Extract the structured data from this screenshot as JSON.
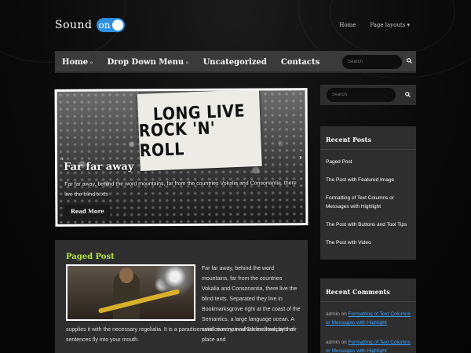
{
  "site": {
    "logo_text": "Sound",
    "logo_toggle": "on",
    "top_nav": [
      "Home",
      "Page layouts ▾"
    ]
  },
  "nav": {
    "items": [
      {
        "label": "Home",
        "arrow": "»"
      },
      {
        "label": "Drop Down Menu",
        "arrow": "»"
      },
      {
        "label": "Uncategorized",
        "arrow": ""
      },
      {
        "label": "Contacts",
        "arrow": ""
      }
    ],
    "search_placeholder": "Search"
  },
  "slider": {
    "sign_line_1": "LONG LIVE",
    "sign_line_2": "ROCK 'N' ROLL",
    "title": "Far far away",
    "text": "Far far away, behind the word mountains, far from the countries Vokalia and Consonantia, there live the blind texts",
    "button": "Read More",
    "prev_icon": "‹",
    "next_icon": "›"
  },
  "post": {
    "title": "Paged Post",
    "text_right": "Far far away, behind the word mountains, far from the countries Vokalia and Consonantia, there live the blind texts. Separated they live in Bookmarksgrove right at the coast of the Semantics, a large language ocean. A small river named Duden flows by their place and",
    "text_bottom": "supplies it with the necessary regelialia. It is a paradisematic country, in which roasted parts of sentences fly into your mouth."
  },
  "sidebar": {
    "search_placeholder": "Search",
    "recent_posts": {
      "title": "Recent Posts",
      "items": [
        "Paged Post",
        "The Post with Featured Image",
        "Formatting of Text Columns or Messages with Highlight",
        "The Post with Buttons and Tool Tips",
        "The Post with Video"
      ]
    },
    "recent_comments": {
      "title": "Recent Comments",
      "items": [
        {
          "author": "admin",
          "on": "on",
          "link": "Formatting of Text Columns or Messages with Highlight"
        },
        {
          "author": "admin",
          "on": "on",
          "link": "Formatting of Text Columns or Messages with Highlight"
        }
      ]
    }
  },
  "colors": {
    "accent": "#2d8fe0",
    "post_title": "#b8e04a",
    "link": "#3aa0ff"
  }
}
